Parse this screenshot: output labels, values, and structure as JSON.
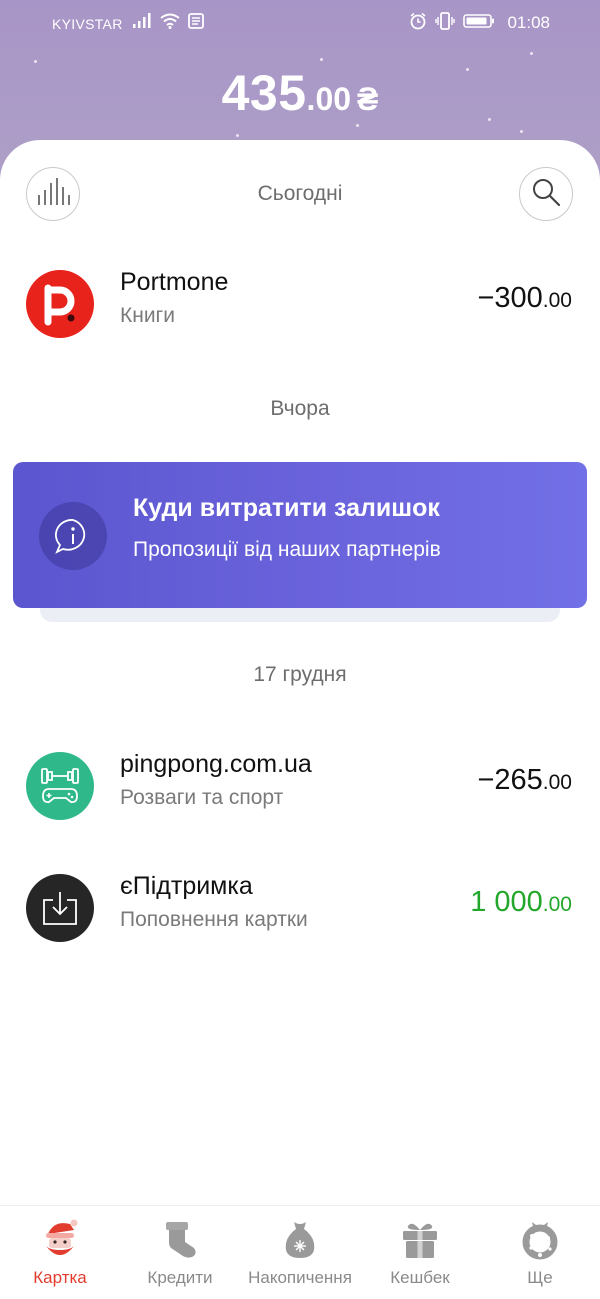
{
  "status_bar": {
    "carrier": "KYIVSTAR",
    "time": "01:08"
  },
  "balance": {
    "integer": "435",
    "fraction": ".00",
    "currency": "₴"
  },
  "header": {
    "today_label": "Сьогодні"
  },
  "sections": {
    "yesterday": "Вчора",
    "dec17": "17 грудня"
  },
  "transactions": [
    {
      "name": "Portmone",
      "category": "Книги",
      "amount_int": "−300",
      "amount_frac": ".00",
      "icon": "portmone-logo",
      "color": "#e8231c"
    },
    {
      "name": "pingpong.com.ua",
      "category": "Розваги та спорт",
      "amount_int": "−265",
      "amount_frac": ".00",
      "icon": "sport-game-icon",
      "color": "#2fb98a"
    },
    {
      "name": "єПідтримка",
      "category": "Поповнення картки",
      "amount_int": "1 000",
      "amount_frac": ".00",
      "icon": "download-tray-icon",
      "color": "#262626"
    }
  ],
  "promo": {
    "title": "Куди витратити залишок",
    "subtitle": "Пропозиції від наших партнерів",
    "icon": "info-chat-icon"
  },
  "nav": [
    {
      "label": "Картка",
      "icon": "santa-card-icon",
      "active": true
    },
    {
      "label": "Кредити",
      "icon": "stocking-icon",
      "active": false
    },
    {
      "label": "Накопичення",
      "icon": "money-bag-icon",
      "active": false
    },
    {
      "label": "Кешбек",
      "icon": "gift-icon",
      "active": false
    },
    {
      "label": "Ще",
      "icon": "wreath-icon",
      "active": false
    }
  ],
  "colors": {
    "header_bg": "#a895c7",
    "promo_bg": "#6a63dc",
    "positive_amount": "#23a72b",
    "active_nav": "#e23c2f"
  }
}
